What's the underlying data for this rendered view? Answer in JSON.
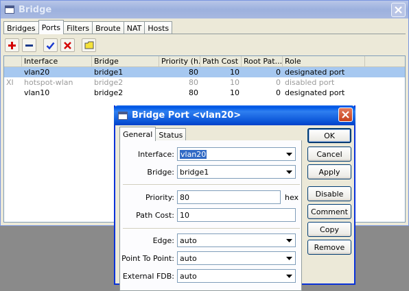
{
  "bridge_window": {
    "title": "Bridge",
    "tabs": [
      "Bridges",
      "Ports",
      "Filters",
      "Broute",
      "NAT",
      "Hosts"
    ],
    "active_tab": "Ports",
    "toolbar": [
      "add-icon",
      "remove-icon",
      "enable-check-icon",
      "disable-x-icon",
      "comment-note-icon"
    ],
    "table": {
      "columns": [
        "",
        "Interface",
        "Bridge",
        "Priority (h...",
        "Path Cost",
        "Root Pat...",
        "Role"
      ],
      "rows": [
        {
          "flag": "",
          "interface": "vlan20",
          "bridge": "bridge1",
          "priority": "80",
          "path_cost": "10",
          "root_path": "0",
          "role": "designated port",
          "state": "selected"
        },
        {
          "flag": "XI",
          "interface": "hotspot-wlan",
          "bridge": "bridge2",
          "priority": "80",
          "path_cost": "10",
          "root_path": "0",
          "role": "disabled port",
          "state": "disabled"
        },
        {
          "flag": "",
          "interface": "vlan10",
          "bridge": "bridge2",
          "priority": "80",
          "path_cost": "10",
          "root_path": "0",
          "role": "designated port",
          "state": "normal"
        }
      ]
    }
  },
  "port_dialog": {
    "title": "Bridge Port <vlan20>",
    "tabs": [
      "General",
      "Status"
    ],
    "active_tab": "General",
    "fields": {
      "interface": {
        "label": "Interface:",
        "value": "vlan20"
      },
      "bridge": {
        "label": "Bridge:",
        "value": "bridge1"
      },
      "priority": {
        "label": "Priority:",
        "value": "80",
        "unit": "hex"
      },
      "path_cost": {
        "label": "Path Cost:",
        "value": "10"
      },
      "edge": {
        "label": "Edge:",
        "value": "auto"
      },
      "point_to_point": {
        "label": "Point To Point:",
        "value": "auto"
      },
      "external_fdb": {
        "label": "External FDB:",
        "value": "auto"
      }
    },
    "buttons": [
      "OK",
      "Cancel",
      "Apply",
      "Disable",
      "Comment",
      "Copy",
      "Remove"
    ]
  },
  "colors": {
    "selection": "#a6c8f0",
    "active_title": "#0b55d8",
    "window_bg": "#ece9d8"
  }
}
